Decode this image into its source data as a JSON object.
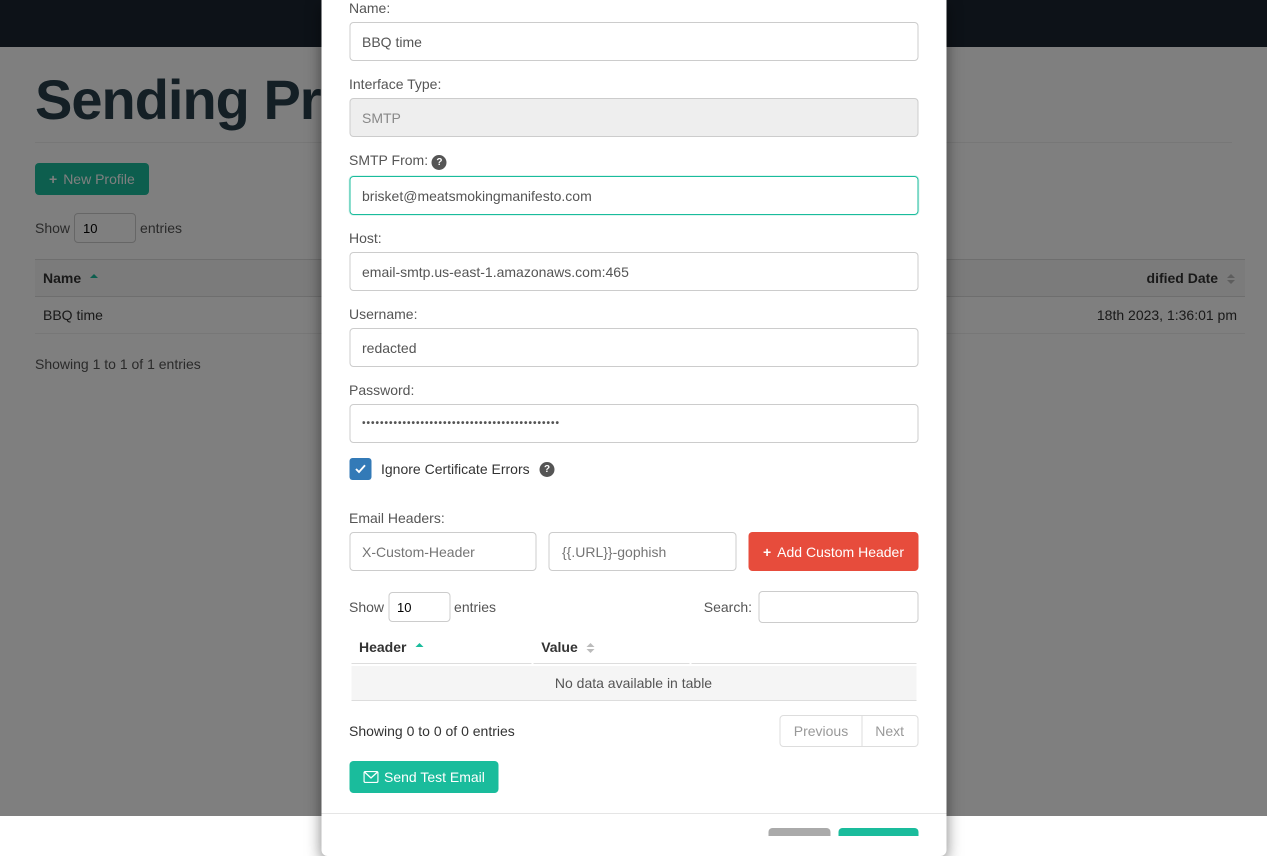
{
  "page": {
    "title": "Sending Pro",
    "newProfile": "New Profile",
    "showPrefix": "Show",
    "showValue": "10",
    "showSuffix": "entries",
    "colName": "Name",
    "colDatePartial": "dified Date",
    "rowName": "BBQ time",
    "rowDatePartial": "18th 2023, 1:36:01 pm",
    "info": "Showing 1 to 1 of 1 entries"
  },
  "modal": {
    "nameLabel": "Name:",
    "nameValue": "BBQ time",
    "interfaceLabel": "Interface Type:",
    "interfaceValue": "SMTP",
    "smtpFromLabel": "SMTP From:",
    "smtpFromValue": "brisket@meatsmokingmanifesto.com",
    "hostLabel": "Host:",
    "hostValue": "email-smtp.us-east-1.amazonaws.com:465",
    "usernameLabel": "Username:",
    "usernameValue": "redacted",
    "passwordLabel": "Password:",
    "passwordValue": "••••••••••••••••••••••••••••••••••••••••••••",
    "ignoreCert": "Ignore Certificate Errors",
    "emailHeadersLabel": "Email Headers:",
    "headerKeyPlaceholder": "X-Custom-Header",
    "headerValPlaceholder": "{{.URL}}-gophish",
    "addHeaderBtn": "Add Custom Header",
    "showPrefix": "Show",
    "showValue": "10",
    "showSuffix": "entries",
    "searchLabel": "Search:",
    "colHeader": "Header",
    "colValue": "Value",
    "noData": "No data available in table",
    "info": "Showing 0 to 0 of 0 entries",
    "prev": "Previous",
    "next": "Next",
    "sendTest": "Send Test Email"
  }
}
